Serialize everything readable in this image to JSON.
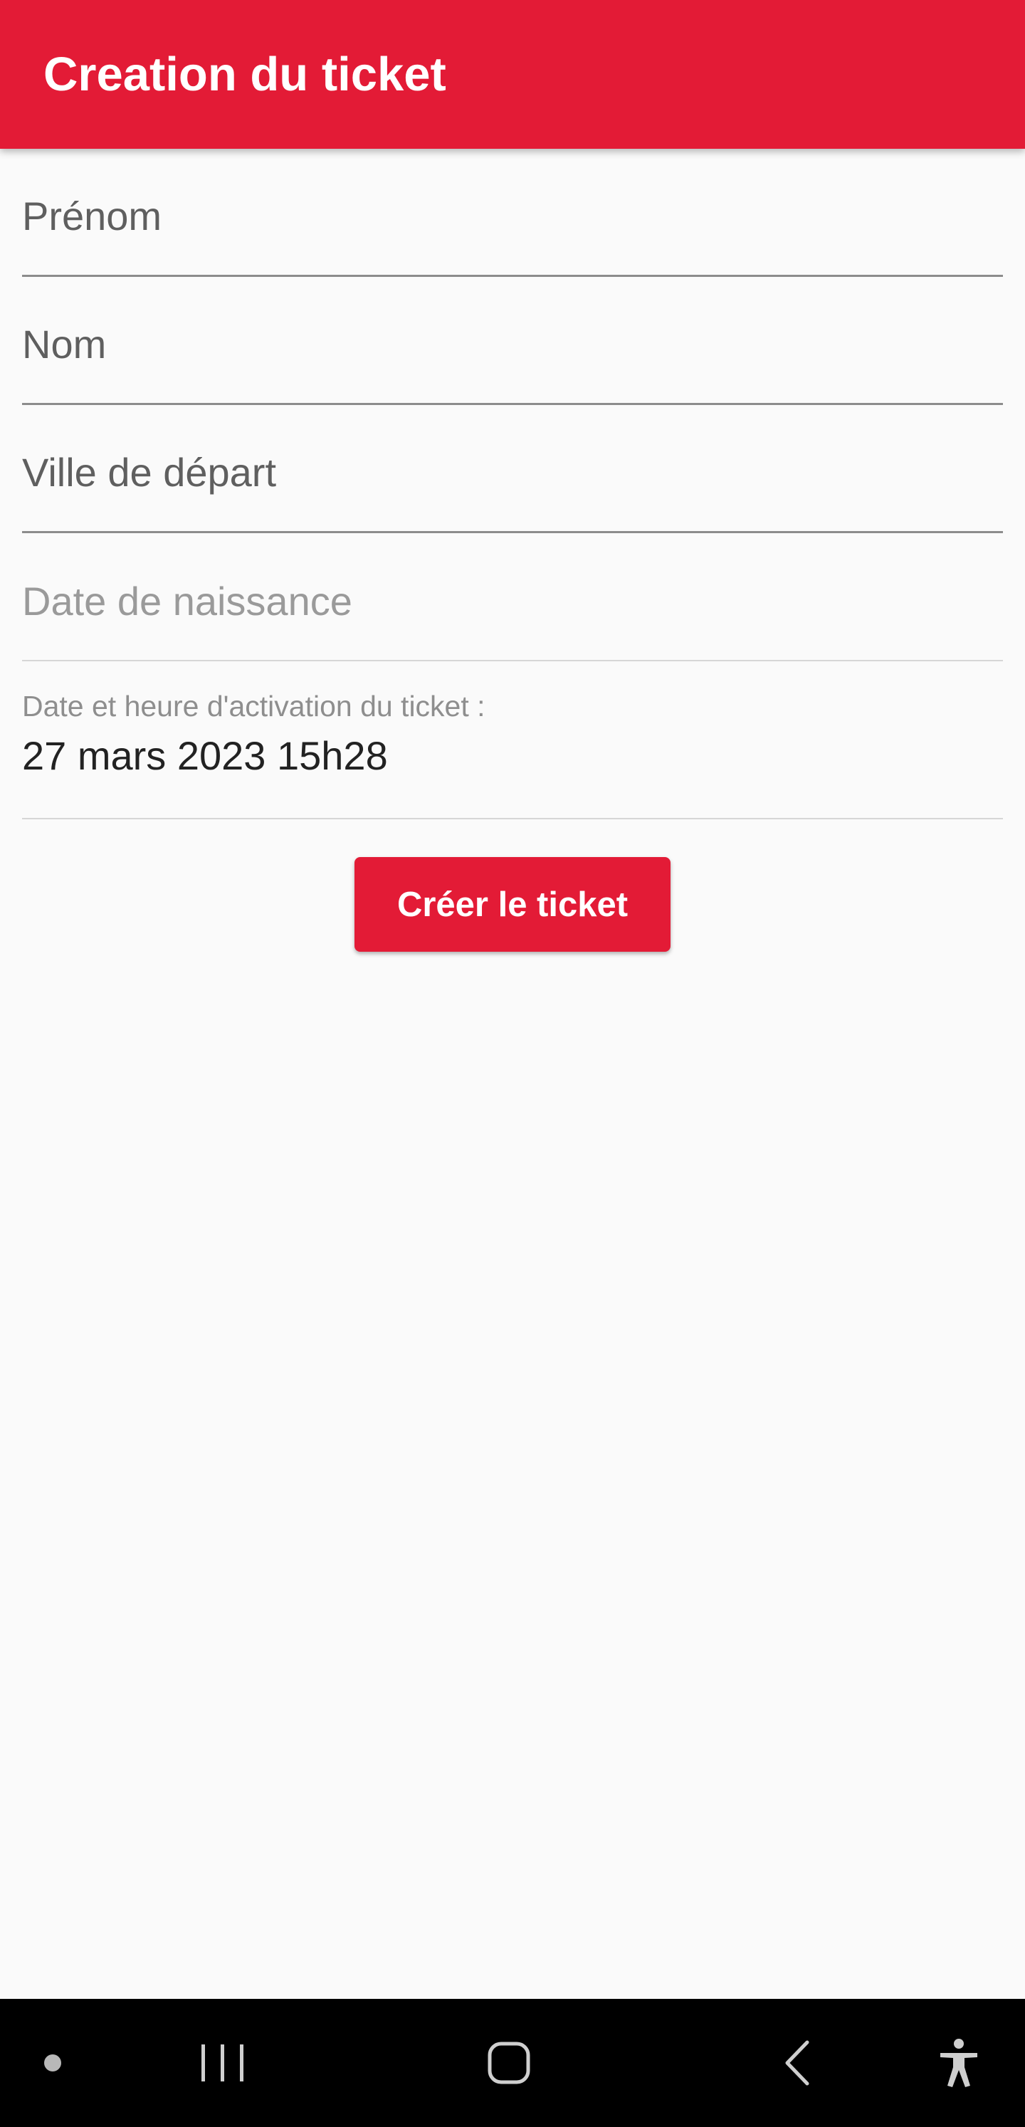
{
  "app_bar": {
    "title": "Creation du ticket",
    "color": "#e31b36"
  },
  "form": {
    "first_name": {
      "placeholder": "Prénom",
      "value": ""
    },
    "last_name": {
      "placeholder": "Nom",
      "value": ""
    },
    "departure_city": {
      "placeholder": "Ville de départ",
      "value": ""
    },
    "birth_date": {
      "placeholder": "Date de naissance",
      "value": ""
    },
    "activation": {
      "label": "Date et heure d'activation du ticket :",
      "value": "27 mars 2023 15h28"
    },
    "submit_label": "Créer le ticket"
  },
  "nav_bar": {
    "items": [
      {
        "icon": "dot-icon"
      },
      {
        "icon": "recent-apps-icon"
      },
      {
        "icon": "home-icon"
      },
      {
        "icon": "back-icon"
      },
      {
        "icon": "accessibility-icon"
      }
    ],
    "color": "#000000"
  }
}
